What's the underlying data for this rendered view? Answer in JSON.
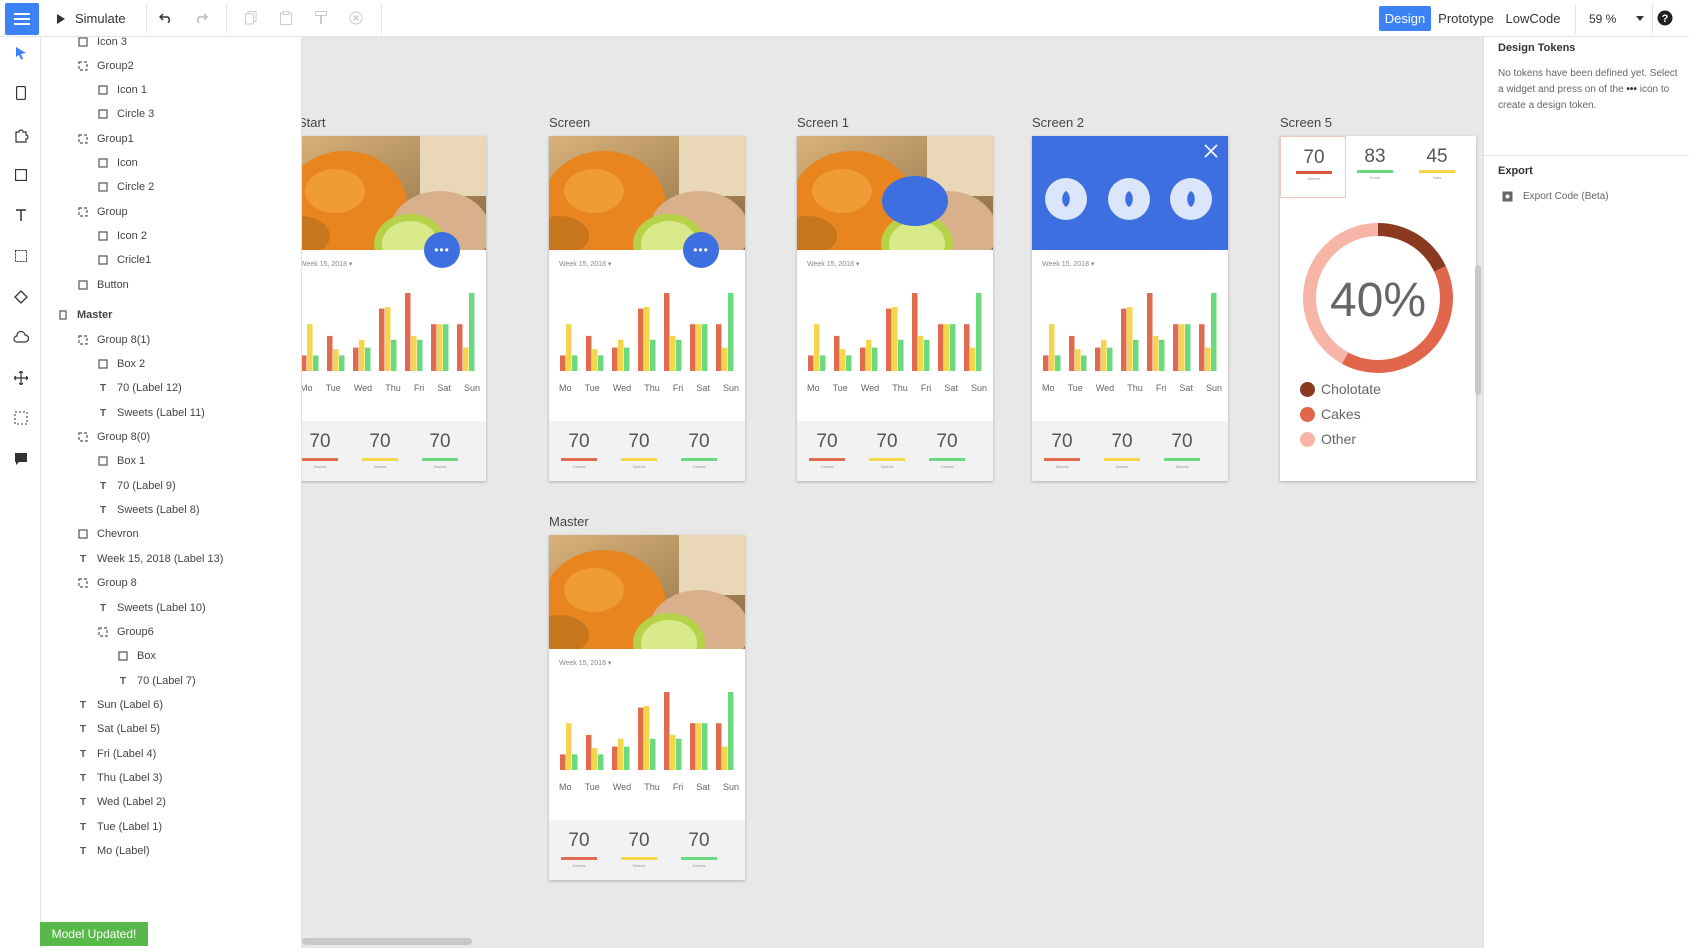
{
  "toolbar": {
    "simulate_label": "Simulate",
    "modes": [
      "Design",
      "Prototype",
      "LowCode"
    ],
    "zoom": "59 %",
    "accent": "#3b82f6"
  },
  "layers": [
    {
      "label": "Icon 3",
      "icon": "rect-icon"
    },
    {
      "label": "Group2",
      "icon": "group-icon"
    },
    {
      "label": "Icon 1",
      "icon": "rect-icon"
    },
    {
      "label": "Circle 3",
      "icon": "rect-icon"
    },
    {
      "label": "Group1",
      "icon": "group-icon"
    },
    {
      "label": "Icon",
      "icon": "rect-icon"
    },
    {
      "label": "Circle 2",
      "icon": "rect-icon"
    },
    {
      "label": "Group",
      "icon": "group-icon"
    },
    {
      "label": "Icon 2",
      "icon": "rect-icon"
    },
    {
      "label": "Cricle1",
      "icon": "rect-icon"
    },
    {
      "label": "Button",
      "icon": "rect-icon"
    },
    {
      "label": "Master",
      "icon": "screen-icon"
    },
    {
      "label": "Group 8(1)",
      "icon": "group-icon"
    },
    {
      "label": "Box 2",
      "icon": "rect-icon"
    },
    {
      "label": "70 (Label 12)",
      "icon": "text-icon"
    },
    {
      "label": "Sweets (Label 11)",
      "icon": "text-icon"
    },
    {
      "label": "Group 8(0)",
      "icon": "group-icon"
    },
    {
      "label": "Box 1",
      "icon": "rect-icon"
    },
    {
      "label": "70 (Label 9)",
      "icon": "text-icon"
    },
    {
      "label": "Sweets (Label 8)",
      "icon": "text-icon"
    },
    {
      "label": "Chevron",
      "icon": "rect-icon"
    },
    {
      "label": "Week 15, 2018 (Label 13)",
      "icon": "text-icon"
    },
    {
      "label": "Group 8",
      "icon": "group-icon"
    },
    {
      "label": "Sweets (Label 10)",
      "icon": "text-icon"
    },
    {
      "label": "Group6",
      "icon": "group-icon"
    },
    {
      "label": "Box",
      "icon": "rect-icon"
    },
    {
      "label": "70 (Label 7)",
      "icon": "text-icon"
    },
    {
      "label": "Sun (Label 6)",
      "icon": "text-icon"
    },
    {
      "label": "Sat (Label 5)",
      "icon": "text-icon"
    },
    {
      "label": "Fri (Label 4)",
      "icon": "text-icon"
    },
    {
      "label": "Thu (Label 3)",
      "icon": "text-icon"
    },
    {
      "label": "Wed (Label 2)",
      "icon": "text-icon"
    },
    {
      "label": "Tue (Label 1)",
      "icon": "text-icon"
    },
    {
      "label": "Mo (Label)",
      "icon": "text-icon"
    }
  ],
  "status": "Model Updated!",
  "screens": {
    "start": "Start",
    "screen": "Screen",
    "screen1": "Screen 1",
    "screen2": "Screen 2",
    "screen5": "Screen 5",
    "master": "Master"
  },
  "card": {
    "week": "Week 15, 2018",
    "days": [
      "Mo",
      "Tue",
      "Wed",
      "Thu",
      "Fri",
      "Sat",
      "Sun"
    ],
    "values": [
      "70",
      "70",
      "70"
    ],
    "captions": [
      "Sweets",
      "Sweets",
      "Sweets"
    ],
    "fab_label": "•••",
    "bar_colors": [
      "#e06b4e",
      "#f2d64b",
      "#6bd97d"
    ]
  },
  "chart_data": {
    "type": "bar",
    "categories": [
      "Mo",
      "Tue",
      "Wed",
      "Thu",
      "Fri",
      "Sat",
      "Sun"
    ],
    "series": [
      {
        "values": [
          20,
          45,
          30,
          80,
          100,
          60,
          60
        ]
      },
      {
        "values": [
          60,
          28,
          40,
          82,
          45,
          60,
          30
        ]
      },
      {
        "values": [
          20,
          20,
          30,
          40,
          40,
          60,
          100
        ]
      }
    ]
  },
  "screen5": {
    "stats": [
      {
        "value": "70",
        "caption": "Sweets",
        "color": "#d9573f"
      },
      {
        "value": "83",
        "caption": "Fruits",
        "color": "#6bd97d"
      },
      {
        "value": "45",
        "caption": "Nuts",
        "color": "#f2d64b"
      }
    ],
    "percent": "40%",
    "legend": [
      {
        "label": "Cholotate",
        "color": "#8b3a22"
      },
      {
        "label": "Cakes",
        "color": "#e0664c"
      },
      {
        "label": "Other",
        "color": "#f7b5a8"
      }
    ]
  },
  "right_panel": {
    "tokens_title": "Design Tokens",
    "tokens_text_1": "No tokens have been defined yet. Select a widget and press on of the",
    "tokens_dots": "•••",
    "tokens_text_2": "icon to create a design token.",
    "export_title": "Export",
    "export_item": "Export Code (Beta)"
  }
}
